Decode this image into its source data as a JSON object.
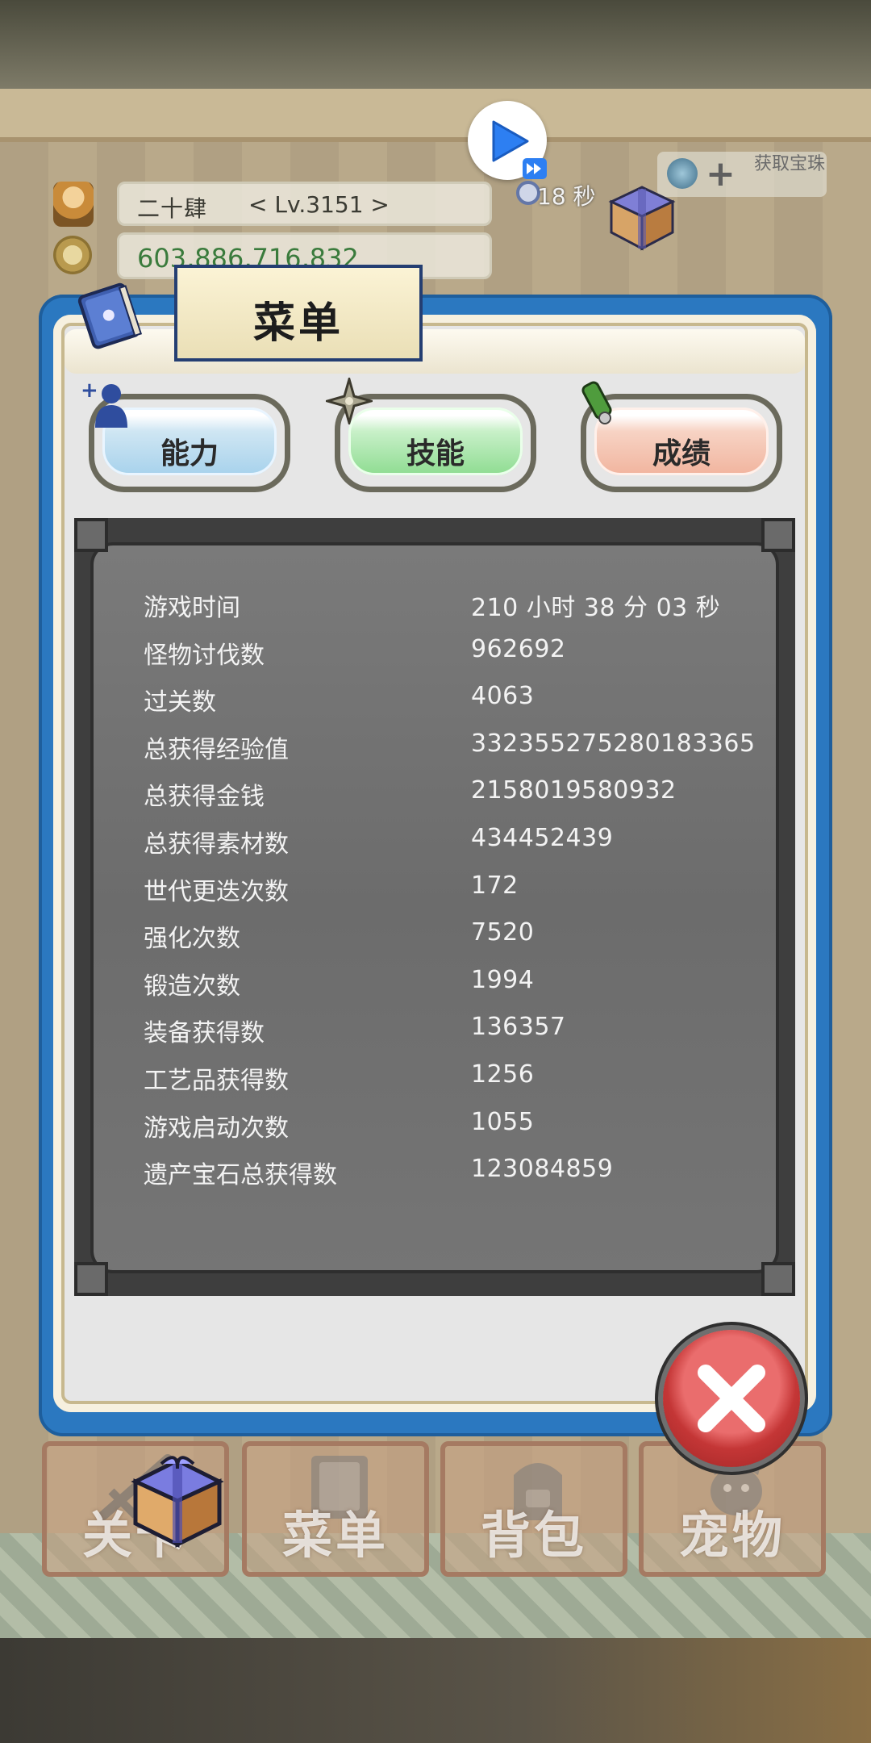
{
  "hud": {
    "player_name": "二十肆",
    "level": "< Lv.3151 >",
    "gold": "603,886,716,832",
    "timer": "18 秒",
    "gem_badge": "获取宝珠"
  },
  "menu": {
    "title": "菜单",
    "tabs": [
      {
        "label": "能力"
      },
      {
        "label": "技能"
      },
      {
        "label": "成绩"
      }
    ]
  },
  "stats": [
    {
      "label": "游戏时间",
      "value": "210 小时 38 分 03 秒"
    },
    {
      "label": "怪物讨伐数",
      "value": "962692"
    },
    {
      "label": "过关数",
      "value": "4063"
    },
    {
      "label": "总获得经验值",
      "value": "332355275280183365"
    },
    {
      "label": "总获得金钱",
      "value": "2158019580932"
    },
    {
      "label": "总获得素材数",
      "value": "434452439"
    },
    {
      "label": "世代更迭次数",
      "value": "172"
    },
    {
      "label": "强化次数",
      "value": "7520"
    },
    {
      "label": "锻造次数",
      "value": "1994"
    },
    {
      "label": "装备获得数",
      "value": "136357"
    },
    {
      "label": "工艺品获得数",
      "value": "1256"
    },
    {
      "label": "游戏启动次数",
      "value": "1055"
    },
    {
      "label": "遗产宝石总获得数",
      "value": "123084859"
    }
  ],
  "nav": [
    {
      "label": "关卡"
    },
    {
      "label": "菜单"
    },
    {
      "label": "背包"
    },
    {
      "label": "宠物"
    }
  ],
  "colors": {
    "dialog_border": "#2b78c0",
    "ability_tab": "#a7d2ec",
    "skill_tab": "#8edc91",
    "record_tab": "#f1b49e",
    "close_button": "#c43636",
    "play_button": "#2d7ff2"
  },
  "icons": [
    "play-icon",
    "fast-forward-icon",
    "timer-icon",
    "gift-icon",
    "book-icon",
    "add-user-icon",
    "shuriken-icon",
    "scroll-icon",
    "close-icon",
    "coin-icon",
    "avatar"
  ]
}
